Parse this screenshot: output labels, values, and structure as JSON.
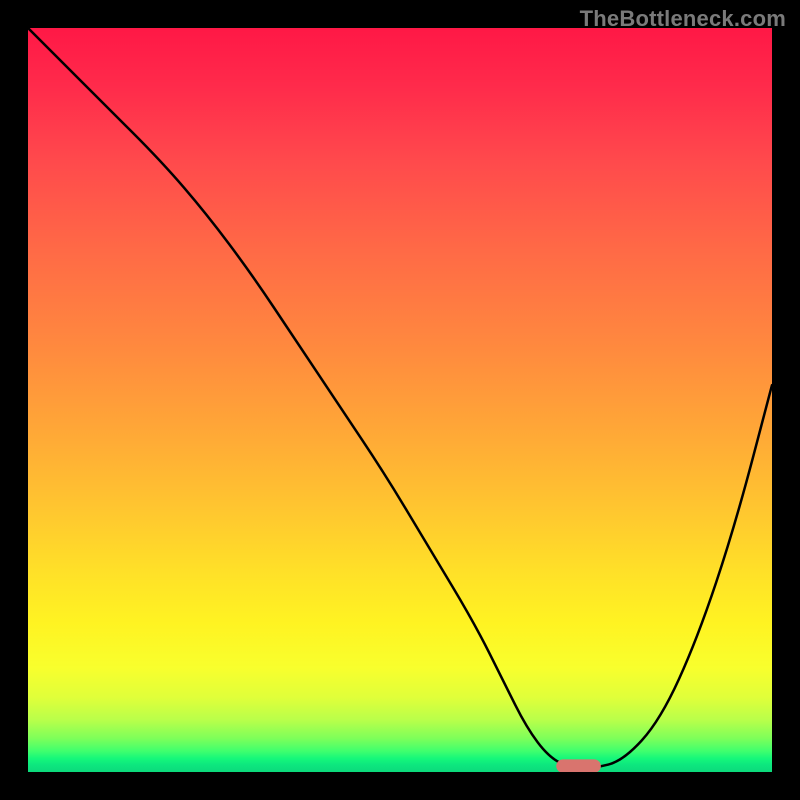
{
  "watermark": "TheBottleneck.com",
  "chart_data": {
    "type": "line",
    "title": "",
    "xlabel": "",
    "ylabel": "",
    "xlim": [
      0,
      100
    ],
    "ylim": [
      0,
      100
    ],
    "grid": false,
    "legend": false,
    "gradient_stops": [
      {
        "pos": 0,
        "color": "#ff1846"
      },
      {
        "pos": 8,
        "color": "#ff2b4b"
      },
      {
        "pos": 18,
        "color": "#ff4a4c"
      },
      {
        "pos": 30,
        "color": "#ff6a46"
      },
      {
        "pos": 42,
        "color": "#ff873f"
      },
      {
        "pos": 54,
        "color": "#ffa737"
      },
      {
        "pos": 64,
        "color": "#ffc430"
      },
      {
        "pos": 73,
        "color": "#ffe028"
      },
      {
        "pos": 80,
        "color": "#fff322"
      },
      {
        "pos": 86,
        "color": "#f8ff2d"
      },
      {
        "pos": 90,
        "color": "#e0ff3a"
      },
      {
        "pos": 93,
        "color": "#b9ff4a"
      },
      {
        "pos": 95.5,
        "color": "#7dff5a"
      },
      {
        "pos": 97.2,
        "color": "#3fff6e"
      },
      {
        "pos": 98.2,
        "color": "#15f77a"
      },
      {
        "pos": 99,
        "color": "#0de77e"
      },
      {
        "pos": 100,
        "color": "#0cd97c"
      }
    ],
    "series": [
      {
        "name": "bottleneck-curve",
        "color": "#000000",
        "x": [
          0,
          4,
          10,
          18,
          24,
          30,
          36,
          42,
          48,
          54,
          60,
          64,
          67,
          70,
          73,
          76,
          80,
          85,
          90,
          95,
          100
        ],
        "y": [
          100,
          96,
          90,
          82,
          75,
          67,
          58,
          49,
          40,
          30,
          20,
          12,
          6,
          2,
          0.5,
          0.5,
          1.5,
          7,
          18,
          33,
          52
        ]
      }
    ],
    "marker": {
      "name": "operating-point",
      "x_range": [
        71,
        77
      ],
      "y": 0.8,
      "color": "#d9746e"
    },
    "notes": "y=0 at bottom, y=100 at top; values are visual estimates from the plot (no numeric axes shown)."
  }
}
